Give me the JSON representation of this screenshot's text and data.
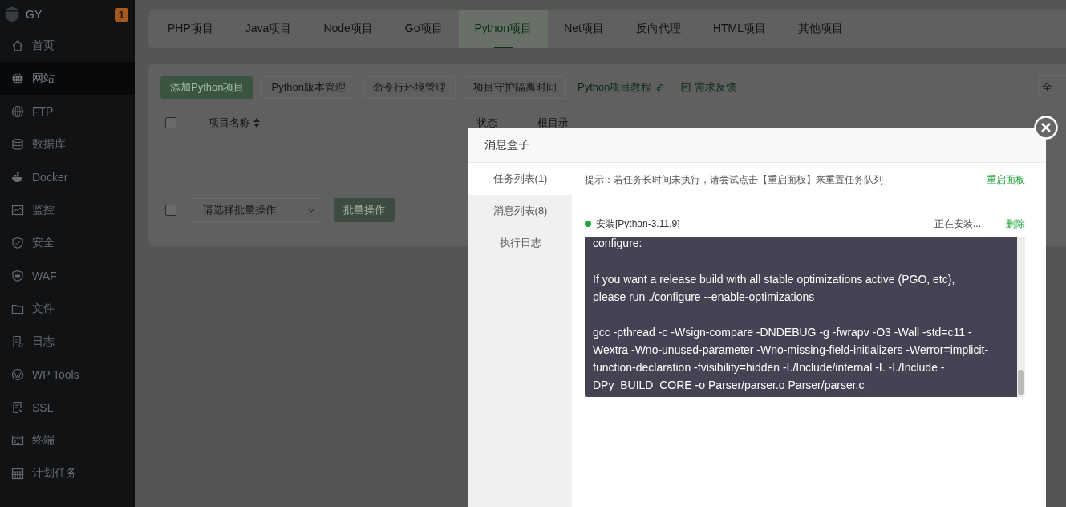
{
  "sidebar": {
    "brand": "GY",
    "badge": "1",
    "items": [
      {
        "label": "首页",
        "selected": false
      },
      {
        "label": "网站",
        "selected": true
      },
      {
        "label": "FTP",
        "selected": false
      },
      {
        "label": "数据库",
        "selected": false
      },
      {
        "label": "Docker",
        "selected": false
      },
      {
        "label": "监控",
        "selected": false
      },
      {
        "label": "安全",
        "selected": false
      },
      {
        "label": "WAF",
        "selected": false
      },
      {
        "label": "文件",
        "selected": false
      },
      {
        "label": "日志",
        "selected": false
      },
      {
        "label": "WP Tools",
        "selected": false
      },
      {
        "label": "SSL",
        "selected": false
      },
      {
        "label": "终端",
        "selected": false
      },
      {
        "label": "计划任务",
        "selected": false
      }
    ]
  },
  "tabs": [
    {
      "label": "PHP项目",
      "selected": false
    },
    {
      "label": "Java项目",
      "selected": false
    },
    {
      "label": "Node项目",
      "selected": false
    },
    {
      "label": "Go项目",
      "selected": false
    },
    {
      "label": "Python项目",
      "selected": true
    },
    {
      "label": "Net项目",
      "selected": false
    },
    {
      "label": "反向代理",
      "selected": false
    },
    {
      "label": "HTML项目",
      "selected": false
    },
    {
      "label": "其他项目",
      "selected": false
    }
  ],
  "toolbar": {
    "buttons": [
      {
        "label": "添加Python项目",
        "kind": "primary"
      },
      {
        "label": "Python版本管理",
        "kind": "default"
      },
      {
        "label": "命令行环境管理",
        "kind": "default"
      },
      {
        "label": "项目守护隔离时间",
        "kind": "default"
      }
    ],
    "links": [
      {
        "label": "Python项目教程"
      },
      {
        "label": "需求反馈"
      }
    ],
    "filter": "全"
  },
  "table": {
    "select_all": {
      "checked": false
    },
    "columns": [
      {
        "label": "项目名称"
      },
      {
        "label": "状态"
      },
      {
        "label": "根目录"
      }
    ]
  },
  "batch": {
    "checked": false,
    "placeholder": "请选择批量操作",
    "button": "批量操作"
  },
  "modal": {
    "title": "消息盒子",
    "nav": [
      {
        "label": "任务列表(1)",
        "selected": true
      },
      {
        "label": "消息列表(8)",
        "selected": false
      },
      {
        "label": "执行日志",
        "selected": false
      }
    ],
    "hint": "提示：若任务长时间未执行，请尝试点击【重启面板】来重置任务队列",
    "restart": "重启面板",
    "task": {
      "name": "安装[Python-3.11.9]",
      "status": "正在安装...",
      "delete": "删除",
      "running": true
    },
    "log": [
      [
        "configure:"
      ],
      [
        "If you want a release build with all stable optimizations active (PGO, etc),",
        "please run ./configure --enable-optimizations"
      ],
      [
        "gcc -pthread -c -Wsign-compare -DNDEBUG -g -fwrapv -O3 -Wall    -std=c11 -",
        "Wextra -Wno-unused-parameter -Wno-missing-field-initializers -Werror=implicit-",
        "function-declaration -fvisibility=hidden  -I./Include/internal  -I. -I./Include    -",
        "DPy_BUILD_CORE -o Parser/parser.o Parser/parser.c"
      ]
    ]
  }
}
